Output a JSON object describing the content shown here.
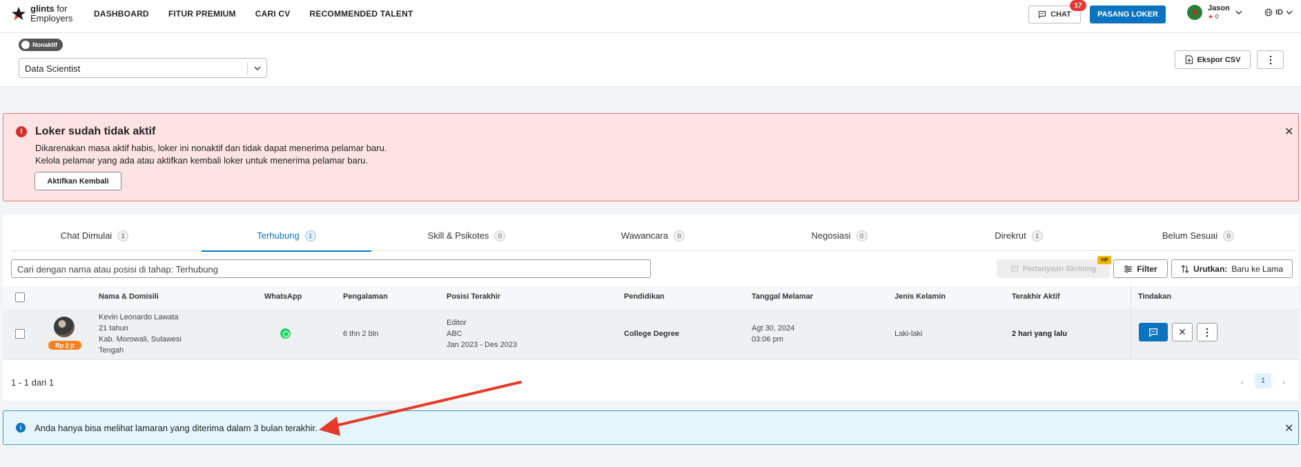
{
  "header": {
    "logo_brand": "glints",
    "logo_suffix": "for",
    "logo_line2": "Employers",
    "nav": [
      "DASHBOARD",
      "FITUR PREMIUM",
      "CARI CV",
      "RECOMMENDED TALENT"
    ],
    "chat_label": "CHAT",
    "chat_badge": "17",
    "post_job_label": "PASANG LOKER",
    "user_name": "Jason",
    "user_stars": "0",
    "language": "ID"
  },
  "job": {
    "status_toggle": "Nonaktif",
    "selected_job": "Data Scientist",
    "export_label": "Ekspor CSV"
  },
  "alert_inactive": {
    "title": "Loker sudah tidak aktif",
    "line1": "Dikarenakan masa aktif habis, loker ini nonaktif dan tidak dapat menerima pelamar baru.",
    "line2": "Kelola pelamar yang ada atau aktifkan kembali loker untuk menerima pelamar baru.",
    "button": "Aktifkan Kembali",
    "color": "#fde3e3"
  },
  "tabs": [
    {
      "label": "Chat Dimulai",
      "count": "1"
    },
    {
      "label": "Terhubung",
      "count": "1"
    },
    {
      "label": "Skill & Psikotes",
      "count": "0"
    },
    {
      "label": "Wawancara",
      "count": "0"
    },
    {
      "label": "Negosiasi",
      "count": "0"
    },
    {
      "label": "Direkrut",
      "count": "1"
    },
    {
      "label": "Belum Sesuai",
      "count": "0"
    }
  ],
  "toolbar": {
    "search_placeholder": "Cari dengan nama atau posisi di tahap: Terhubung",
    "screening_label": "Pertanyaan Skrining",
    "vip_badge": "VIP",
    "filter_label": "Filter",
    "sort_prefix": "Urutkan:",
    "sort_value": "Baru ke Lama"
  },
  "table": {
    "headers": [
      "Nama & Domisili",
      "WhatsApp",
      "Pengalaman",
      "Posisi Terakhir",
      "Pendidikan",
      "Tanggal Melamar",
      "Jenis Kelamin",
      "Terakhir Aktif",
      "Tindakan"
    ],
    "rows": [
      {
        "name": "Kevin Leonardo Lawata",
        "age": "21 tahun",
        "location_line1": "Kab. Morowali, Sulawesi",
        "location_line2": "Tengah",
        "salary_badge": "Rp 2 jt",
        "experience": "6 thn 2 bln",
        "last_position_title": "Editor",
        "last_position_company": "ABC",
        "last_position_period": "Jan 2023 - Des 2023",
        "education": "College Degree",
        "applied_date": "Agt 30, 2024",
        "applied_time": "03:06 pm",
        "gender": "Laki-laki",
        "last_active": "2 hari yang lalu"
      }
    ]
  },
  "pagination": {
    "range_text": "1 - 1 dari 1",
    "current_page": "1"
  },
  "info_alert": {
    "text": "Anda hanya bisa melihat lamaran yang diterima dalam 3 bulan terakhir.",
    "color": "#e4f5fb"
  },
  "colors": {
    "primary": "#0b74c0",
    "error_border": "#e57373",
    "salary_badge": "#f5811f",
    "annotation_arrow": "#e53a2a"
  }
}
